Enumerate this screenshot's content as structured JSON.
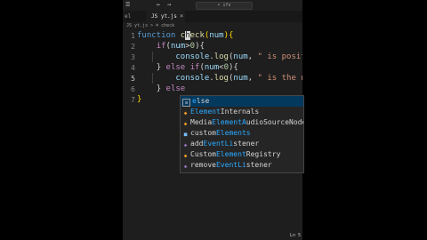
{
  "titlebar": {
    "menu_icon": "hamburger-menu-icon",
    "back_glyph": "←",
    "forward_glyph": "→",
    "search_text": "⌕ ifs"
  },
  "tabs": [
    {
      "label": "el"
    },
    {
      "label": "JS yt.js",
      "active": true,
      "close": "×"
    }
  ],
  "breadcrumb": "JS yt.js > ⌘ check",
  "editor": {
    "line_numbers": [
      "1",
      "2",
      "3",
      "4",
      "5",
      "6",
      "7"
    ],
    "current_line": "5",
    "lines": [
      [
        {
          "t": "function ",
          "c": "kw"
        },
        {
          "t": "c",
          "c": "fn"
        },
        {
          "t": "h",
          "c": "cursor"
        },
        {
          "t": "eck",
          "c": "fn"
        },
        {
          "t": "(",
          "c": "brk"
        },
        {
          "t": "num",
          "c": "var"
        },
        {
          "t": ")",
          "c": "brk"
        },
        {
          "t": "{",
          "c": "brk"
        }
      ],
      [
        {
          "t": "    "
        },
        {
          "t": "if",
          "c": "ctl"
        },
        {
          "t": "(",
          "c": "pun"
        },
        {
          "t": "num",
          "c": "var"
        },
        {
          "t": ">",
          "c": "pun"
        },
        {
          "t": "0",
          "c": "num"
        },
        {
          "t": "){",
          "c": "pun"
        }
      ],
      [
        {
          "t": "        "
        },
        {
          "t": "console",
          "c": "var"
        },
        {
          "t": ".",
          "c": "pun"
        },
        {
          "t": "log",
          "c": "fn"
        },
        {
          "t": "(",
          "c": "pun"
        },
        {
          "t": "num",
          "c": "var"
        },
        {
          "t": ", ",
          "c": "pun"
        },
        {
          "t": "\" is positive\"",
          "c": "str"
        }
      ],
      [
        {
          "t": "    "
        },
        {
          "t": "} ",
          "c": "pun"
        },
        {
          "t": "else ",
          "c": "ctl"
        },
        {
          "t": "if",
          "c": "ctl"
        },
        {
          "t": "(",
          "c": "pun"
        },
        {
          "t": "num",
          "c": "var"
        },
        {
          "t": "<",
          "c": "pun"
        },
        {
          "t": "0",
          "c": "num"
        },
        {
          "t": "){",
          "c": "pun"
        }
      ],
      [
        {
          "t": "        "
        },
        {
          "t": "console",
          "c": "var"
        },
        {
          "t": ".",
          "c": "pun"
        },
        {
          "t": "log",
          "c": "fn"
        },
        {
          "t": "(",
          "c": "pun"
        },
        {
          "t": "num",
          "c": "var"
        },
        {
          "t": ", ",
          "c": "pun"
        },
        {
          "t": "\" is the negat",
          "c": "str"
        }
      ],
      [
        {
          "t": "    "
        },
        {
          "t": "} ",
          "c": "pun"
        },
        {
          "t": "else",
          "c": "ctl"
        }
      ],
      [
        {
          "t": "}",
          "c": "brk"
        }
      ]
    ]
  },
  "suggestions": [
    {
      "label": "else",
      "kind": "keyword",
      "icon": "keyword-icon",
      "match": [
        0,
        4
      ],
      "selected": true
    },
    {
      "label": "ElementInternals",
      "kind": "class",
      "icon": "class-icon",
      "match": [
        0,
        1,
        2,
        3,
        4,
        5,
        6
      ],
      "selected": false
    },
    {
      "label": "MediaElementAudioSourceNode",
      "kind": "class",
      "icon": "class-icon",
      "match": [
        5,
        6,
        7,
        8,
        9,
        10,
        11,
        12
      ],
      "selected": false
    },
    {
      "label": "customElements",
      "kind": "property",
      "icon": "property-icon",
      "match": [
        6,
        7,
        8,
        9,
        10,
        11,
        12,
        13
      ],
      "selected": false
    },
    {
      "label": "addEventListener",
      "kind": "method",
      "icon": "method-icon",
      "match": [
        3,
        4,
        5,
        6,
        7,
        8,
        9
      ],
      "selected": false
    },
    {
      "label": "CustomElementRegistry",
      "kind": "class",
      "icon": "class-icon",
      "match": [
        6,
        7,
        8,
        9,
        10,
        11,
        12
      ],
      "selected": false
    },
    {
      "label": "removeEventListener",
      "kind": "method",
      "icon": "method-icon",
      "match": [
        6,
        7,
        8,
        9,
        10,
        11,
        12
      ],
      "selected": false
    }
  ],
  "statusbar": {
    "text": "Ln 5"
  }
}
